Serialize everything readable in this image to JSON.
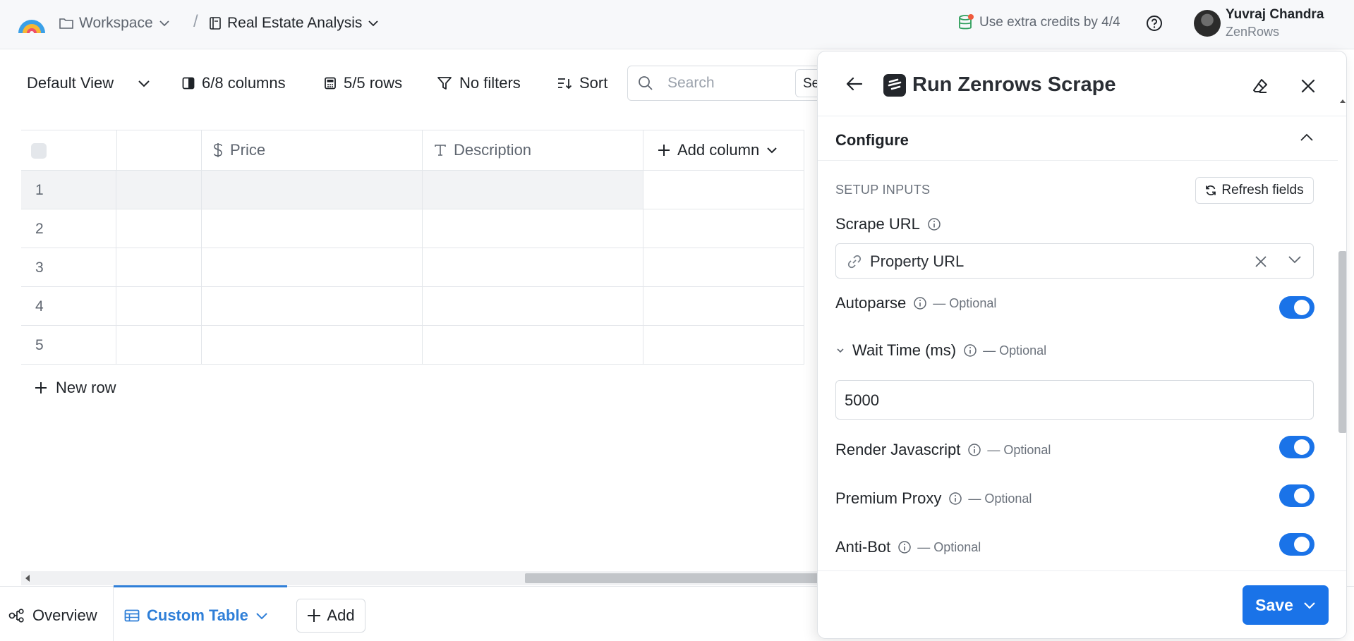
{
  "topbar": {
    "workspace": "Workspace",
    "breadcrumb_sep": "/",
    "page": "Real Estate Analysis",
    "credits": "Use extra credits by 4/4",
    "user_name": "Yuvraj Chandra",
    "user_org": "ZenRows"
  },
  "toolbar": {
    "view": "Default View",
    "columns": "6/8 columns",
    "rows": "5/5 rows",
    "filters": "No filters",
    "sort": "Sort",
    "search_placeholder": "Search",
    "search_button": "Se"
  },
  "table": {
    "columns": [
      {
        "label": "",
        "icon": ""
      },
      {
        "label": "Price",
        "icon": "dollar-icon"
      },
      {
        "label": "Description",
        "icon": "text-type-icon"
      }
    ],
    "add_column": "Add column",
    "row_numbers": [
      "1",
      "2",
      "3",
      "4",
      "5"
    ],
    "new_row": "New row"
  },
  "tabs": {
    "overview": "Overview",
    "custom_table": "Custom Table",
    "add": "Add"
  },
  "panel": {
    "title": "Run Zenrows Scrape",
    "section": "Configure",
    "setup_inputs": "SETUP INPUTS",
    "refresh": "Refresh fields",
    "scrape_url_label": "Scrape URL",
    "scrape_url_value": "Property URL",
    "optional": "— Optional",
    "fields": {
      "autoparse": {
        "label": "Autoparse",
        "enabled": true
      },
      "wait_time": {
        "label": "Wait Time (ms)",
        "value": "5000"
      },
      "render_js": {
        "label": "Render Javascript",
        "enabled": true
      },
      "premium_proxy": {
        "label": "Premium Proxy",
        "enabled": true
      },
      "anti_bot": {
        "label": "Anti-Bot",
        "enabled": true
      }
    },
    "save": "Save"
  },
  "colors": {
    "accent": "#1a73e8",
    "tab_active": "#2f7fd8",
    "border": "#e3e6ea",
    "muted_text": "#5f6670"
  }
}
